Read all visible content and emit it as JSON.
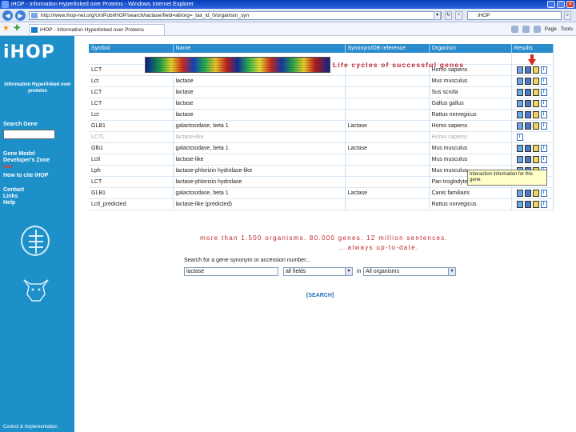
{
  "browser": {
    "window_title": "iHOP - Information Hyperlinked over Proteins - Windows Internet Explorer",
    "url": "http://www.ihop-net.org/UniPub/iHOP/search/lactase/field=all/org=_tax_id_0/organism_syn",
    "search_placeholder": "iHOP",
    "tab_title": "iHOP - Information Hyperlinked over Proteins",
    "tools": [
      "Page",
      "Tools"
    ]
  },
  "sidebar": {
    "logo_text": "iHOP",
    "tagline": "Information Hyperlinked over proteins",
    "search_gene_label": "Search Gene",
    "links_group1": [
      "Gene Model",
      "Developer's Zone"
    ],
    "new_badge": "new",
    "how_to_cite": "How to cite iHOP",
    "links_group2": [
      "Contact",
      "Links",
      "Help"
    ],
    "footer": "Control & Implementation"
  },
  "table": {
    "headers": [
      "Symbol",
      "Name",
      "Synonym/DB reference",
      "Organism",
      "Results"
    ],
    "banner_text": "Life cycles of successful genes",
    "rows": [
      {
        "symbol": "LCT",
        "name": "lactase",
        "synonym": "",
        "organism": "Homo sapiens"
      },
      {
        "symbol": "Lct",
        "name": "lactase",
        "synonym": "",
        "organism": "Mus musculus"
      },
      {
        "symbol": "LCT",
        "name": "lactase",
        "synonym": "",
        "organism": "Sus scrofa"
      },
      {
        "symbol": "LCT",
        "name": "lactase",
        "synonym": "",
        "organism": "Gallus gallus"
      },
      {
        "symbol": "Lct",
        "name": "lactase",
        "synonym": "",
        "organism": "Rattus norvegicus"
      },
      {
        "symbol": "GLB1",
        "name": "galactosidase, beta 1",
        "synonym": "Lactase",
        "organism": "Homo sapiens"
      },
      {
        "symbol": "LCTL",
        "name": "lactase-like",
        "synonym": "",
        "organism": "Homo sapiens",
        "dim": true
      },
      {
        "symbol": "Glb1",
        "name": "galactosidase, beta 1",
        "synonym": "Lactase",
        "organism": "Mus musculus"
      },
      {
        "symbol": "Lctl",
        "name": "lactase-like",
        "synonym": "",
        "organism": "Mus musculus"
      },
      {
        "symbol": "Lph",
        "name": "lactase-phlorizin hydrolase-like",
        "synonym": "",
        "organism": "Mus musculus"
      },
      {
        "symbol": "LCT",
        "name": "lactase-phlorizin hydrolase",
        "synonym": "",
        "organism": "Pan troglodytes"
      },
      {
        "symbol": "GLB1",
        "name": "galactosidase, beta 1",
        "synonym": "Lactase",
        "organism": "Canis familiaris"
      },
      {
        "symbol": "Lctl_predicted",
        "name": "lactase-like (predicted)",
        "synonym": "",
        "organism": "Rattus norvegicus"
      }
    ]
  },
  "tooltip": "Interaction information for this gene.",
  "stats_line1": "more than 1.500 organisms. 80.000 genes. 12 million sentences.",
  "stats_line2": "...always up-to-date.",
  "form": {
    "label": "Search for a gene synonym or accession number...",
    "query_value": "lactase",
    "field_value": "all fields",
    "in_label": "in",
    "organism_value": "All organisms",
    "submit_label": "[SEARCH]"
  },
  "colors": {
    "sidebar": "#1e90c9",
    "header": "#2a8ccd",
    "accent_red": "#c0262a"
  }
}
